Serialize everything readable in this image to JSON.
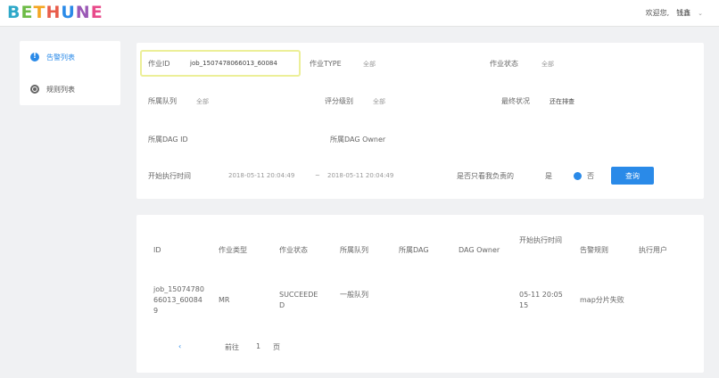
{
  "header": {
    "logo_letters": [
      {
        "ch": "B",
        "color": "#2ea8c8"
      },
      {
        "ch": "E",
        "color": "#6dbb45"
      },
      {
        "ch": "T",
        "color": "#f5a623"
      },
      {
        "ch": "H",
        "color": "#e85c4a"
      },
      {
        "ch": "U",
        "color": "#2a8ae8"
      },
      {
        "ch": "N",
        "color": "#9b59b6"
      },
      {
        "ch": "E",
        "color": "#e84a8a"
      }
    ],
    "welcome": "欢迎您,",
    "user": "钱鑫"
  },
  "sidebar": {
    "items": [
      {
        "label": "告警列表",
        "active": true
      },
      {
        "label": "规则列表",
        "active": false
      }
    ]
  },
  "filters": {
    "job_id_label": "作业ID",
    "job_id_value": "job_1507478066013_60084",
    "job_type_label": "作业TYPE",
    "job_type_value": "全部",
    "job_status_label": "作业状态",
    "job_status_value": "全部",
    "queue_label": "所属队列",
    "queue_value": "全部",
    "score_label": "评分级别",
    "score_value": "全部",
    "handle_label": "最终状况",
    "handle_value": "还在排查",
    "dag_id_label": "所属DAG ID",
    "dag_owner_label": "所属DAG Owner",
    "time_label": "开始执行时间",
    "time_start": "2018-05-11 20:04:49",
    "time_sep": "~",
    "time_end": "2018-05-11 20:04:49",
    "only_mine_label": "是否只看我负责的",
    "only_mine_yes": "是",
    "only_mine_no": "否",
    "search_button": "查询"
  },
  "table": {
    "columns": [
      "ID",
      "作业类型",
      "作业状态",
      "所属队列",
      "所属DAG",
      "DAG Owner",
      "开始执行时间",
      "告警规则",
      "执行用户"
    ],
    "row": {
      "id": "job_15074780 66013_60084 9",
      "type": "MR",
      "status": "SUCCEEDE D",
      "queue": "一般队列",
      "dag": "",
      "owner": "",
      "start": "05-11 20:05 15",
      "rule": "map分片失败",
      "user": ""
    },
    "pager": {
      "prev": "‹",
      "page_label": "前往",
      "page_num": "1",
      "page_suffix": "页"
    }
  }
}
